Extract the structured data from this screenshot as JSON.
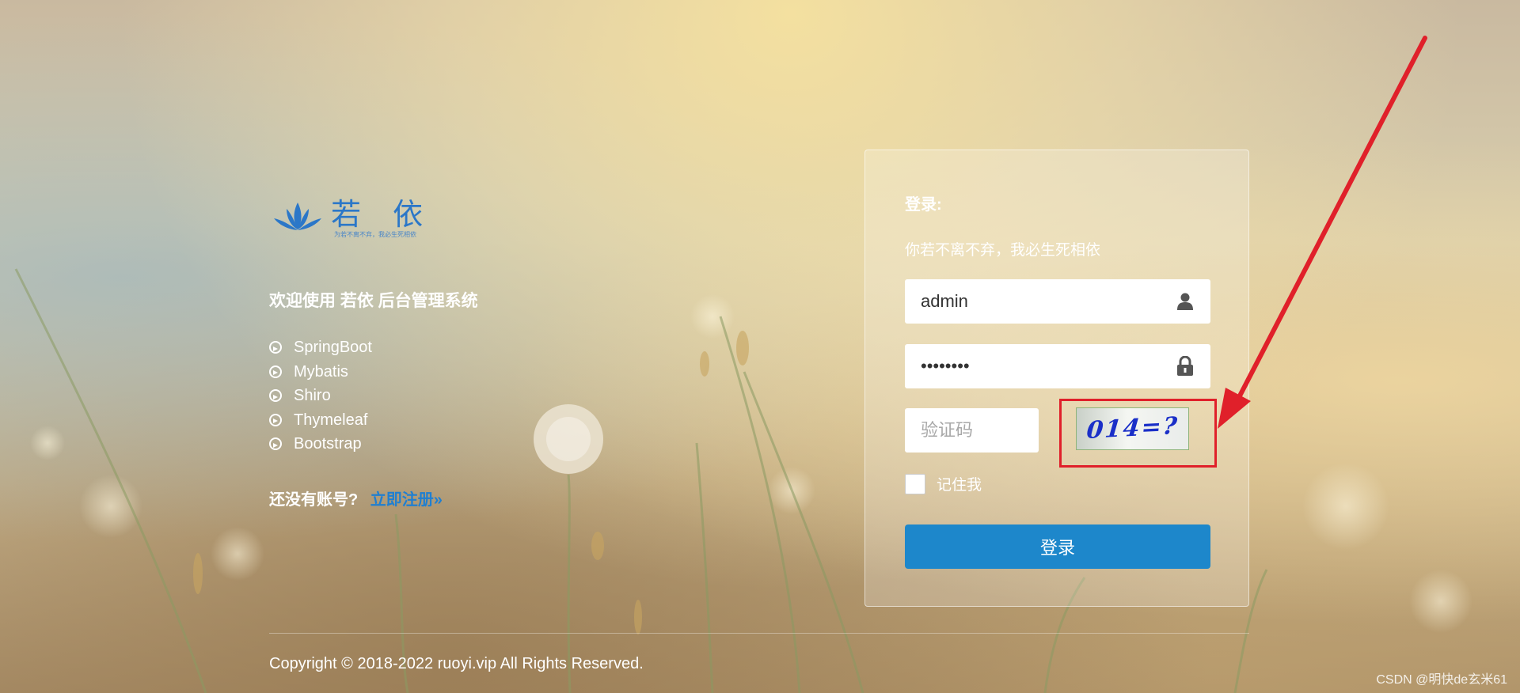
{
  "colors": {
    "accent": "#1d87cb",
    "link": "#1f7fd1",
    "logo": "#2b77c8",
    "annotation": "#e0202a"
  },
  "brand": {
    "logo_text": "若 依",
    "logo_slogan": "为若不离不弃，我必生死相依",
    "welcome": "欢迎使用 若依 后台管理系统",
    "tech": [
      "SpringBoot",
      "Mybatis",
      "Shiro",
      "Thymeleaf",
      "Bootstrap"
    ],
    "register_prompt": "还没有账号?",
    "register_link": "立即注册»"
  },
  "login": {
    "title": "登录:",
    "subtitle": "你若不离不弃，我必生死相依",
    "username_value": "admin",
    "username_icon": "user-icon",
    "password_value": "••••••••",
    "password_icon": "lock-icon",
    "captcha_placeholder": "验证码",
    "captcha_text": "014=?",
    "remember_label": "记住我",
    "submit_label": "登录"
  },
  "footer": {
    "copyright": "Copyright © 2018-2022 ruoyi.vip All Rights Reserved.",
    "watermark": "CSDN @明快de玄米61"
  }
}
